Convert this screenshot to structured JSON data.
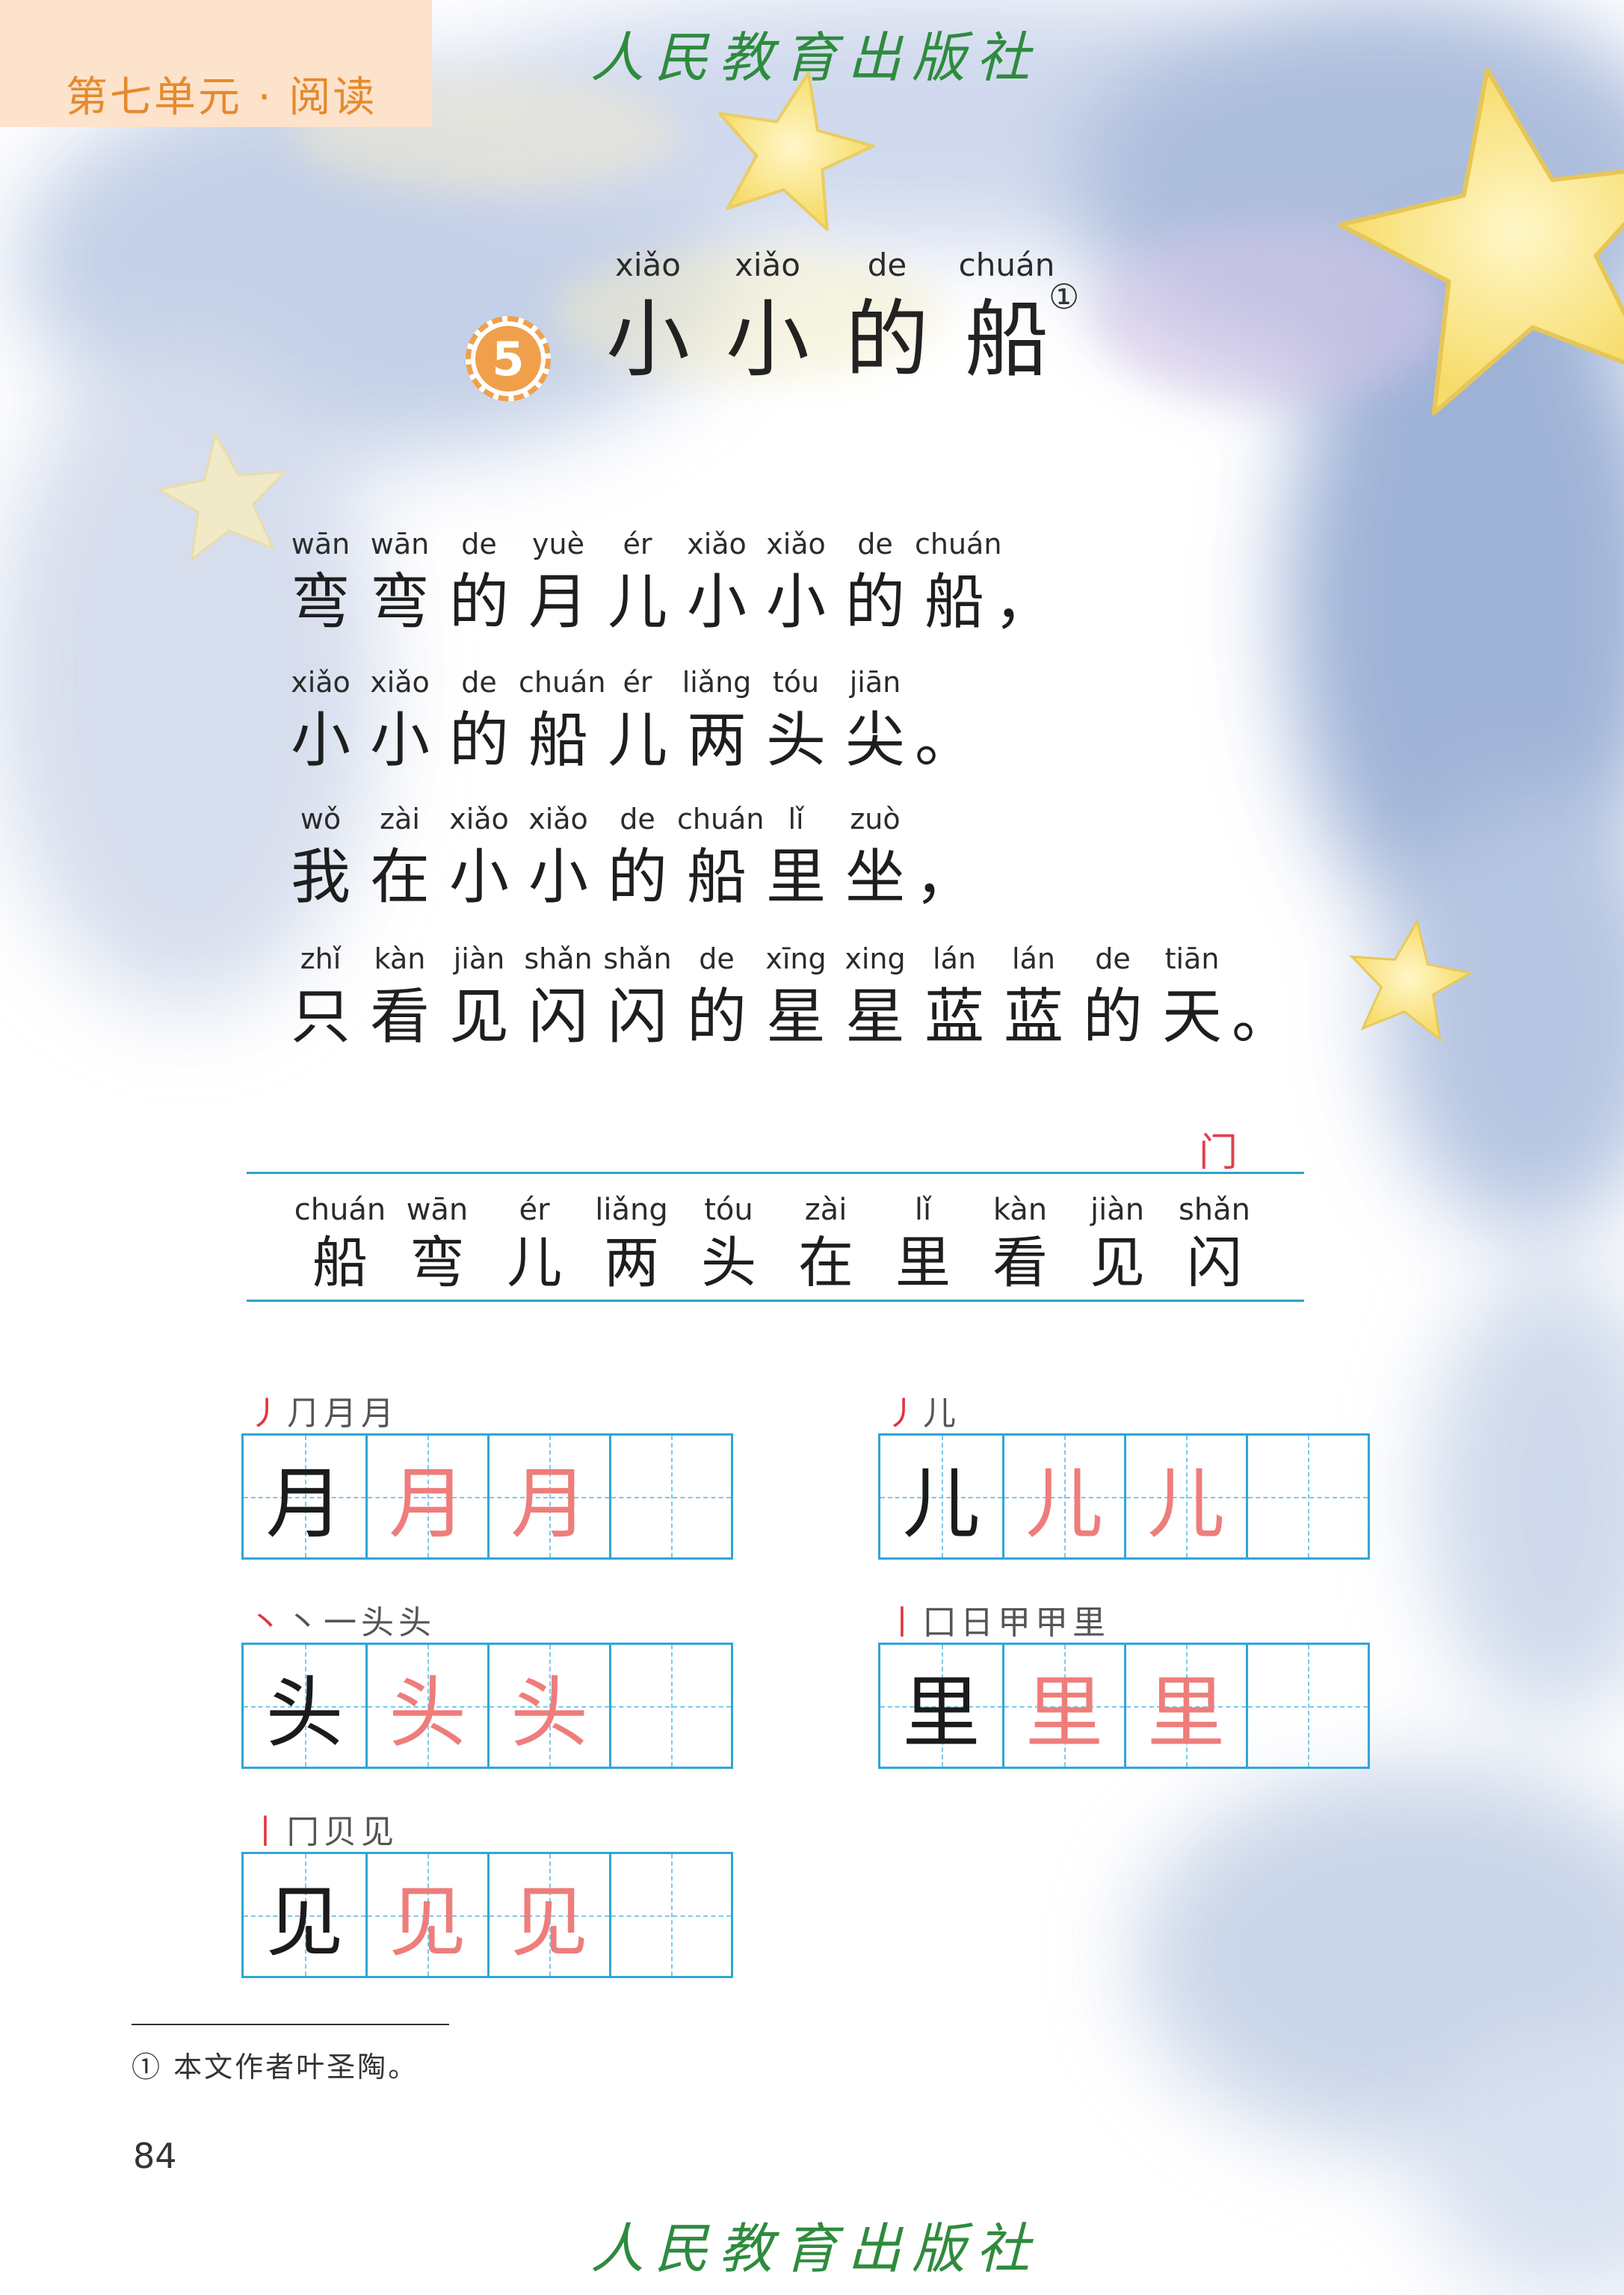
{
  "header": {
    "unit_label": "第七单元 · 阅读",
    "publisher": "人民教育出版社"
  },
  "lesson": {
    "number": "5",
    "title": [
      {
        "pinyin": "xiǎo",
        "char": "小"
      },
      {
        "pinyin": "xiǎo",
        "char": "小"
      },
      {
        "pinyin": "de",
        "char": "的"
      },
      {
        "pinyin": "chuán",
        "char": "船"
      }
    ],
    "footnote_mark": "①"
  },
  "poem": [
    [
      {
        "p": "wān",
        "c": "弯"
      },
      {
        "p": "wān",
        "c": "弯"
      },
      {
        "p": "de",
        "c": "的"
      },
      {
        "p": "yuè",
        "c": "月"
      },
      {
        "p": "ér",
        "c": "儿"
      },
      {
        "p": "xiǎo",
        "c": "小"
      },
      {
        "p": "xiǎo",
        "c": "小"
      },
      {
        "p": "de",
        "c": "的"
      },
      {
        "p": "chuán",
        "c": "船"
      },
      {
        "p": "",
        "c": "，"
      }
    ],
    [
      {
        "p": "xiǎo",
        "c": "小"
      },
      {
        "p": "xiǎo",
        "c": "小"
      },
      {
        "p": "de",
        "c": "的"
      },
      {
        "p": "chuán",
        "c": "船"
      },
      {
        "p": "ér",
        "c": "儿"
      },
      {
        "p": "liǎng",
        "c": "两"
      },
      {
        "p": "tóu",
        "c": "头"
      },
      {
        "p": "jiān",
        "c": "尖"
      },
      {
        "p": "",
        "c": "。"
      }
    ],
    [
      {
        "p": "wǒ",
        "c": "我"
      },
      {
        "p": "zài",
        "c": "在"
      },
      {
        "p": "xiǎo",
        "c": "小"
      },
      {
        "p": "xiǎo",
        "c": "小"
      },
      {
        "p": "de",
        "c": "的"
      },
      {
        "p": "chuán",
        "c": "船"
      },
      {
        "p": "lǐ",
        "c": "里"
      },
      {
        "p": "zuò",
        "c": "坐"
      },
      {
        "p": "",
        "c": "，"
      }
    ],
    [
      {
        "p": "zhǐ",
        "c": "只"
      },
      {
        "p": "kàn",
        "c": "看"
      },
      {
        "p": "jiàn",
        "c": "见"
      },
      {
        "p": "shǎn",
        "c": "闪"
      },
      {
        "p": "shǎn",
        "c": "闪"
      },
      {
        "p": "de",
        "c": "的"
      },
      {
        "p": "xīng",
        "c": "星"
      },
      {
        "p": "xing",
        "c": "星"
      },
      {
        "p": "lán",
        "c": "蓝"
      },
      {
        "p": "lán",
        "c": "蓝"
      },
      {
        "p": "de",
        "c": "的"
      },
      {
        "p": "tiān",
        "c": "天"
      },
      {
        "p": "",
        "c": "。"
      }
    ]
  ],
  "recognize": {
    "radical_hint": "门",
    "chars": [
      {
        "p": "chuán",
        "c": "船"
      },
      {
        "p": "wān",
        "c": "弯"
      },
      {
        "p": "ér",
        "c": "儿"
      },
      {
        "p": "liǎng",
        "c": "两"
      },
      {
        "p": "tóu",
        "c": "头"
      },
      {
        "p": "zài",
        "c": "在"
      },
      {
        "p": "lǐ",
        "c": "里"
      },
      {
        "p": "kàn",
        "c": "看"
      },
      {
        "p": "jiàn",
        "c": "见"
      },
      {
        "p": "shǎn",
        "c": "闪"
      }
    ]
  },
  "writing": [
    {
      "char": "月",
      "strokes": [
        "丿",
        "⺆",
        "月",
        "月"
      ]
    },
    {
      "char": "儿",
      "strokes": [
        "丿",
        "儿"
      ]
    },
    {
      "char": "头",
      "strokes": [
        "丶",
        "丶",
        "一",
        "头",
        "头"
      ]
    },
    {
      "char": "里",
      "strokes": [
        "丨",
        "囗",
        "日",
        "甲",
        "甲",
        "里"
      ]
    },
    {
      "char": "见",
      "strokes": [
        "丨",
        "冂",
        "贝",
        "见"
      ]
    }
  ],
  "footnote": {
    "text": "① 本文作者叶圣陶。"
  },
  "page_number": "84",
  "colors": {
    "accent_orange": "#f0a04b",
    "grid_blue": "#2fa6d8",
    "trace_pink": "#ee7d7b",
    "publisher_green": "#2e8b3e"
  }
}
